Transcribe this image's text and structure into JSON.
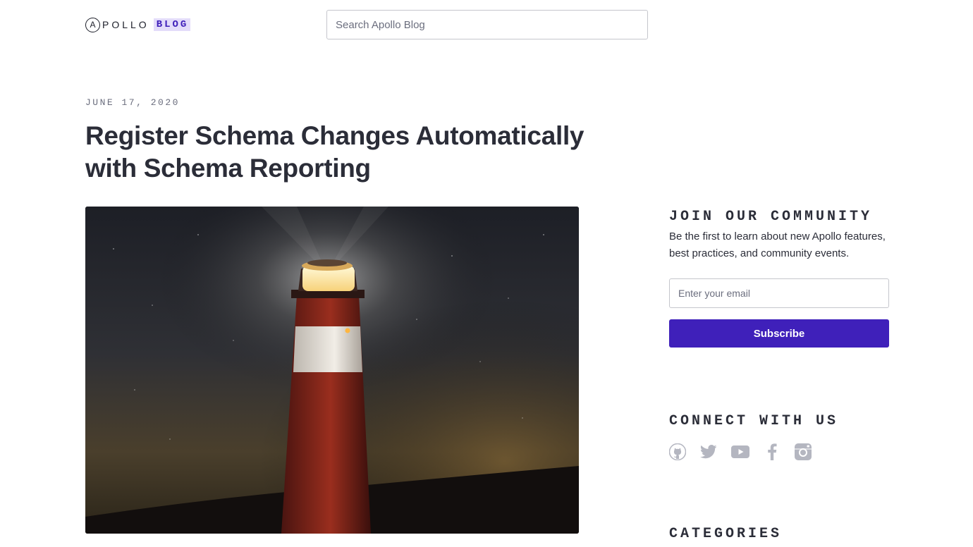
{
  "header": {
    "logo_text": "APOLLO",
    "logo_badge": "BLOG",
    "search_placeholder": "Search Apollo Blog"
  },
  "article": {
    "date": "JUNE 17, 2020",
    "title": "Register Schema Changes Automatically with Schema Reporting",
    "hero_image": "lighthouse-night-photo"
  },
  "sidebar": {
    "join": {
      "heading": "JOIN OUR COMMUNITY",
      "description": "Be the first to learn about new Apollo features, best practices, and community events.",
      "email_placeholder": "Enter your email",
      "subscribe_label": "Subscribe"
    },
    "connect": {
      "heading": "CONNECT WITH US",
      "icons": [
        "github-icon",
        "twitter-icon",
        "youtube-icon",
        "facebook-icon",
        "instagram-icon"
      ]
    },
    "categories": {
      "heading": "CATEGORIES"
    }
  },
  "colors": {
    "brand": "#3f20ba",
    "badge_bg": "#e3dcfa",
    "text": "#2b2d38",
    "muted": "#6b6e7e",
    "icon": "#b4b6c0"
  }
}
